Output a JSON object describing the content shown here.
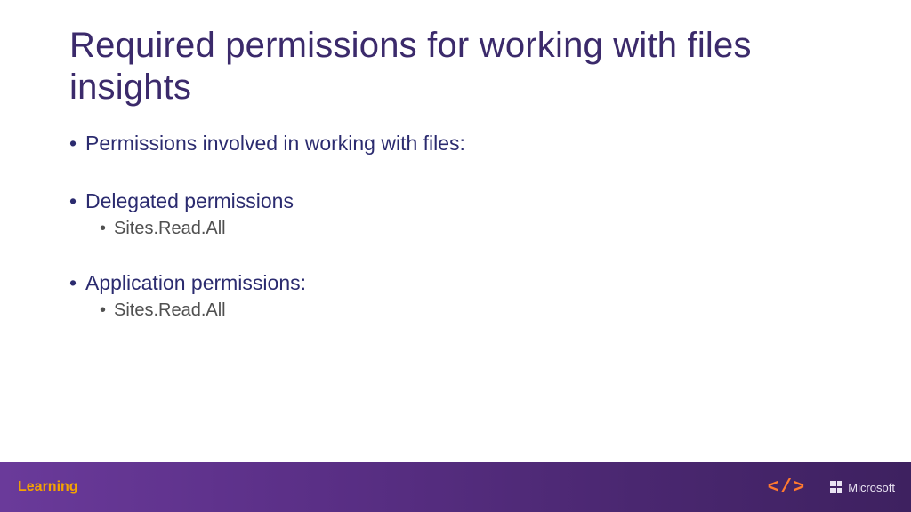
{
  "title": "Required permissions for working with files insights",
  "bullets": [
    {
      "level": 1,
      "text": "Permissions involved in working with files:"
    },
    {
      "spacer": true
    },
    {
      "level": 1,
      "text": "Delegated permissions"
    },
    {
      "level": 2,
      "text": "Sites.Read.All"
    },
    {
      "spacer": true
    },
    {
      "level": 1,
      "text": "Application permissions:"
    },
    {
      "level": 2,
      "text": "Sites.Read.All"
    }
  ],
  "footer": {
    "left_label": "Learning",
    "ampersand": "&",
    "code_bracket": "</>",
    "brand": "Microsoft"
  },
  "colors": {
    "title": "#3b2a6b",
    "bullet_l1": "#2b2b6f",
    "bullet_l2": "#505050",
    "footer_bg_from": "#6a3a9a",
    "footer_bg_to": "#3e2160",
    "footer_left": "#f5a300",
    "code_bracket": "#ff7a2f",
    "brand_text": "#e9e3f2",
    "ampersand": "#b47fd6"
  }
}
